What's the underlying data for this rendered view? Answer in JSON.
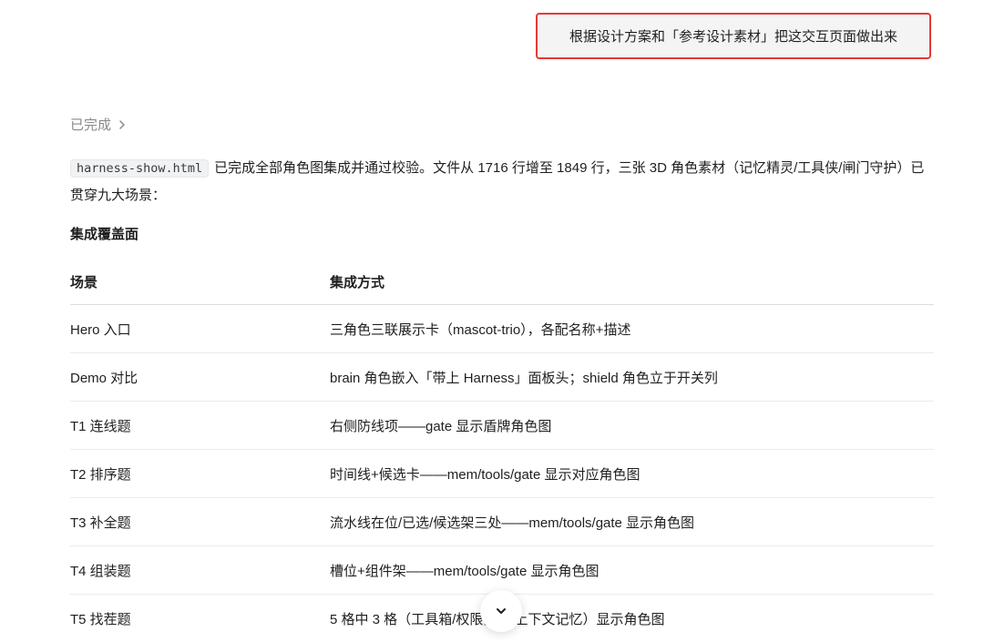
{
  "user_message": {
    "text": "根据设计方案和「参考设计素材」把这交互页面做出来"
  },
  "status": {
    "label": "已完成"
  },
  "summary": {
    "file_name": "harness-show.html",
    "text": "已完成全部角色图集成并通过校验。文件从 1716 行增至 1849 行，三张 3D 角色素材（记忆精灵/工具侠/闸门守护）已贯穿九大场景："
  },
  "section": {
    "title": "集成覆盖面"
  },
  "table": {
    "headers": [
      "场景",
      "集成方式"
    ],
    "rows": [
      [
        "Hero 入口",
        "三角色三联展示卡（mascot-trio），各配名称+描述"
      ],
      [
        "Demo 对比",
        "brain 角色嵌入「带上 Harness」面板头；shield 角色立于开关列"
      ],
      [
        "T1 连线题",
        "右侧防线项——gate 显示盾牌角色图"
      ],
      [
        "T2 排序题",
        "时间线+候选卡——mem/tools/gate 显示对应角色图"
      ],
      [
        "T3 补全题",
        "流水线在位/已选/候选架三处——mem/tools/gate 显示角色图"
      ],
      [
        "T4 组装题",
        "槽位+组件架——mem/tools/gate 显示角色图"
      ],
      [
        "T5 找茬题",
        "5 格中 3 格（工具箱/权限闸门/上下文记忆）显示角色图"
      ]
    ]
  },
  "icons": {
    "status_chevron": "chevron-right-icon",
    "scroll_down": "chevron-down-icon"
  },
  "colors": {
    "highlight_border": "#e53935",
    "muted_text": "#8a8a8a"
  }
}
